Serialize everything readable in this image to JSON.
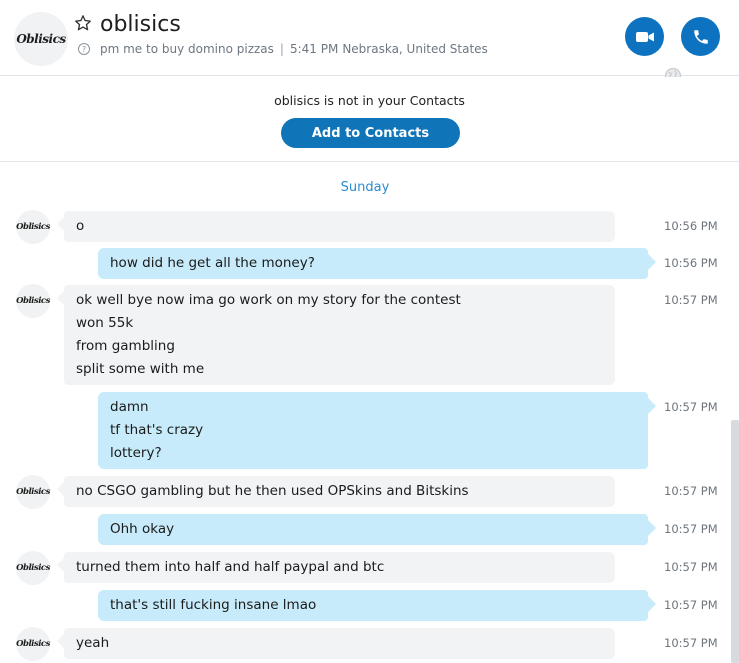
{
  "header": {
    "avatar_logo": "Oblisics",
    "title": "oblisics",
    "mood": "pm me to buy domino pizzas",
    "separator": "|",
    "time": "5:41 PM",
    "location": "Nebraska, United States",
    "video_icon": "video-camera-icon",
    "phone_icon": "phone-icon"
  },
  "banner": {
    "text": "oblisics is not in your Contacts",
    "add_button": "Add to Contacts"
  },
  "chat": {
    "day_label": "Sunday",
    "avatar_logo": "Oblisics",
    "messages": [
      {
        "dir": "in",
        "lines": [
          "o"
        ],
        "time": "10:56 PM"
      },
      {
        "dir": "out",
        "lines": [
          "how did he get all the money?"
        ],
        "time": "10:56 PM"
      },
      {
        "dir": "in",
        "lines": [
          "ok well bye now ima go work on my story for the contest",
          "won 55k",
          "from gambling",
          "split some with me"
        ],
        "time": "10:57 PM"
      },
      {
        "dir": "out",
        "lines": [
          "damn",
          "tf that's crazy",
          "lottery?"
        ],
        "time": "10:57 PM"
      },
      {
        "dir": "in",
        "lines": [
          "no CSGO gambling but he then used OPSkins and Bitskins"
        ],
        "time": "10:57 PM"
      },
      {
        "dir": "out",
        "lines": [
          "Ohh okay"
        ],
        "time": "10:57 PM"
      },
      {
        "dir": "in",
        "lines": [
          "turned them into half and half paypal and btc"
        ],
        "time": "10:57 PM"
      },
      {
        "dir": "out",
        "lines": [
          "that's still fucking insane lmao"
        ],
        "time": "10:57 PM"
      },
      {
        "dir": "in",
        "lines": [
          "yeah"
        ],
        "time": "10:57 PM"
      }
    ]
  },
  "colors": {
    "accent": "#0d73c1",
    "incoming_bubble": "#f1f3f5",
    "outgoing_bubble": "#c7ebfa",
    "day_label": "#2a8bd0"
  }
}
